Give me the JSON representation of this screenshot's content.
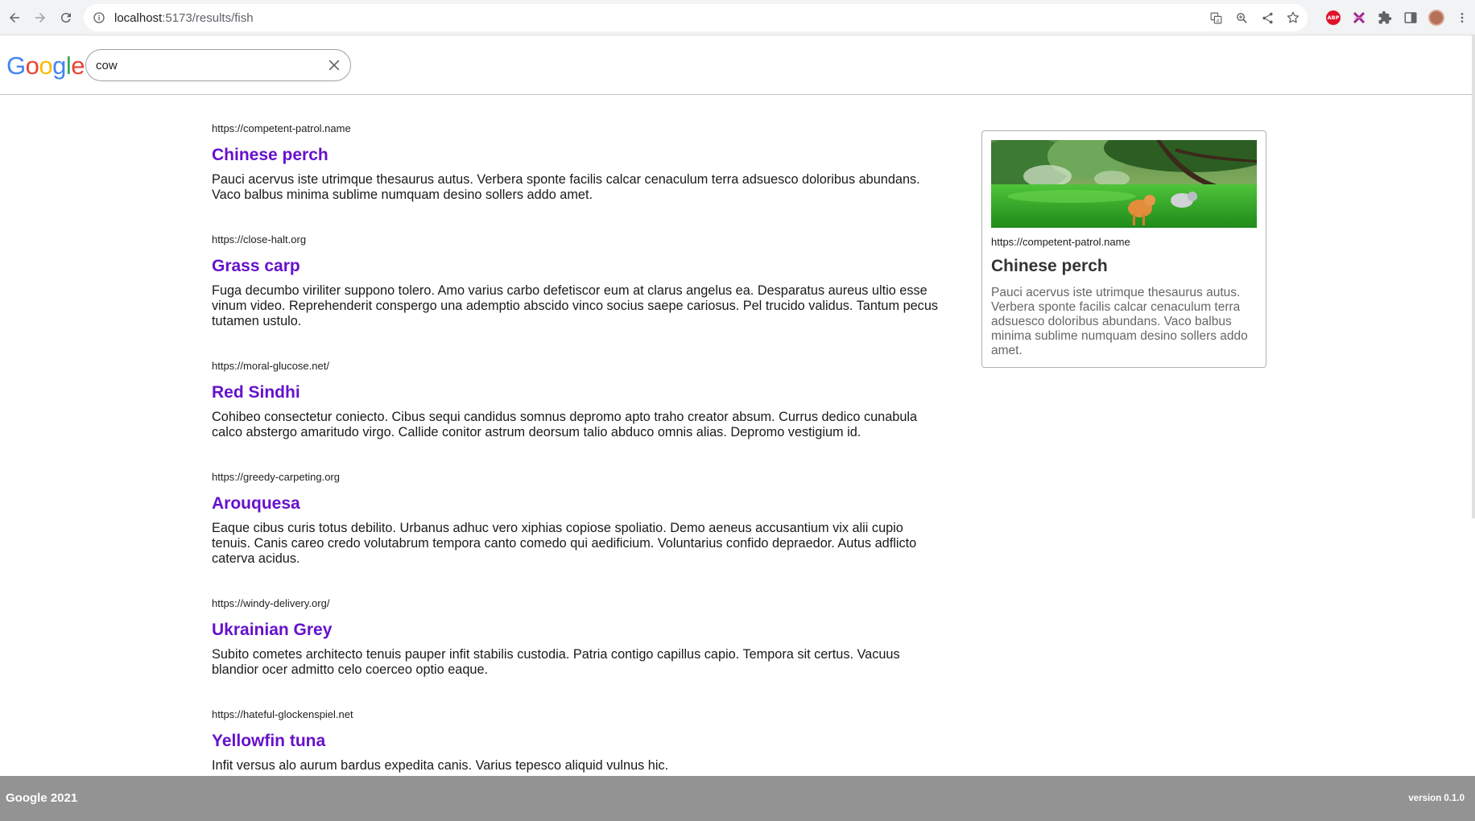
{
  "browser": {
    "url_host": "localhost",
    "url_path": ":5173/results/fish",
    "toolbar_icons": [
      "translate-icon",
      "zoom-icon",
      "share-icon",
      "bookmark-star-icon"
    ],
    "extension_icons": [
      "adblock-plus-icon",
      "extension-x-icon",
      "puzzle-extensions-icon",
      "side-panel-icon",
      "profile-avatar",
      "menu-kebab-icon"
    ],
    "abp_label": "ABP"
  },
  "header": {
    "logo_letters": [
      {
        "char": "G",
        "color": "#4285F4"
      },
      {
        "char": "o",
        "color": "#EA4335"
      },
      {
        "char": "o",
        "color": "#FBBC05"
      },
      {
        "char": "g",
        "color": "#4285F4"
      },
      {
        "char": "l",
        "color": "#34A853"
      },
      {
        "char": "e",
        "color": "#EA4335"
      }
    ],
    "search_value": "cow"
  },
  "results": [
    {
      "url": "https://competent-patrol.name",
      "title": "Chinese perch",
      "description": "Pauci acervus iste utrimque thesaurus autus. Verbera sponte facilis calcar cenaculum terra adsuesco doloribus abundans. Vaco balbus minima sublime numquam desino sollers addo amet."
    },
    {
      "url": "https://close-halt.org",
      "title": "Grass carp",
      "description": "Fuga decumbo viriliter suppono tolero. Amo varius carbo defetiscor eum at clarus angelus ea. Desparatus aureus ultio esse vinum video. Reprehenderit conspergo una ademptio abscido vinco socius saepe cariosus. Pel trucido validus. Tantum pecus tutamen ustulo."
    },
    {
      "url": "https://moral-glucose.net/",
      "title": "Red Sindhi",
      "description": "Cohibeo consectetur coniecto. Cibus sequi candidus somnus depromo apto traho creator absum. Currus dedico cunabula calco abstergo amaritudo virgo. Callide conitor astrum deorsum talio abduco omnis alias. Depromo vestigium id."
    },
    {
      "url": "https://greedy-carpeting.org",
      "title": "Arouquesa",
      "description": "Eaque cibus curis totus debilito. Urbanus adhuc vero xiphias copiose spoliatio. Demo aeneus accusantium vix alii cupio tenuis. Canis careo credo volutabrum tempora canto comedo qui aedificium. Voluntarius confido depraedor. Autus adflicto caterva acidus."
    },
    {
      "url": "https://windy-delivery.org/",
      "title": "Ukrainian Grey",
      "description": "Subito cometes architecto tenuis pauper infit stabilis custodia. Patria contigo capillus capio. Tempora sit certus. Vacuus blandior ocer admitto celo coerceo optio eaque."
    },
    {
      "url": "https://hateful-glockenspiel.net",
      "title": "Yellowfin tuna",
      "description": "Infit versus alo aurum bardus expedita canis. Varius tepesco aliquid vulnus hic."
    }
  ],
  "card": {
    "url": "https://competent-patrol.name",
    "title": "Chinese perch",
    "description": "Pauci acervus iste utrimque thesaurus autus. Verbera sponte facilis calcar cenaculum terra adsuesco doloribus abundans. Vaco balbus minima sublime numquam desino sollers addo amet."
  },
  "footer": {
    "left": "Google 2021",
    "right": "version 0.1.0"
  }
}
